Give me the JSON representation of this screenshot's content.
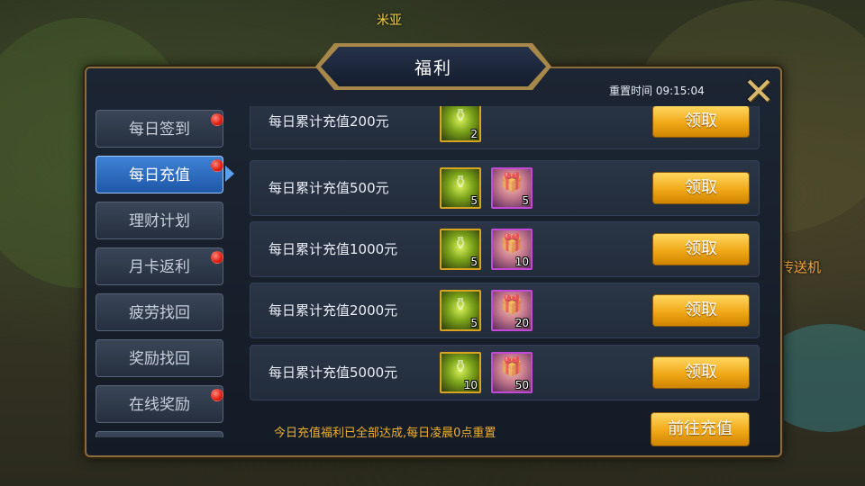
{
  "world": {
    "npc_name": "米亚",
    "portal_name": "传送机"
  },
  "panel": {
    "title": "福利",
    "reset_time": "重置时间 09:15:04",
    "close_icon": "close-x-icon"
  },
  "sidebar": {
    "items": [
      {
        "label": "每日签到",
        "badge": true,
        "active": false
      },
      {
        "label": "每日充值",
        "badge": true,
        "active": true
      },
      {
        "label": "理财计划",
        "badge": false,
        "active": false
      },
      {
        "label": "月卡返利",
        "badge": true,
        "active": false
      },
      {
        "label": "疲劳找回",
        "badge": false,
        "active": false
      },
      {
        "label": "奖励找回",
        "badge": false,
        "active": false
      },
      {
        "label": "在线奖励",
        "badge": true,
        "active": false
      }
    ]
  },
  "rewards": {
    "rows": [
      {
        "label": "每日累计充值200元",
        "items": [
          {
            "type": "gold",
            "icon": "potion-jar-icon",
            "count": "2"
          }
        ],
        "button": "领取"
      },
      {
        "label": "每日累计充值500元",
        "items": [
          {
            "type": "gold",
            "icon": "potion-jar-icon",
            "count": "5"
          },
          {
            "type": "purple",
            "icon": "gift-girl-icon",
            "count": "5"
          }
        ],
        "button": "领取"
      },
      {
        "label": "每日累计充值1000元",
        "items": [
          {
            "type": "gold",
            "icon": "potion-jar-icon",
            "count": "5"
          },
          {
            "type": "purple",
            "icon": "gift-girl-icon",
            "count": "10"
          }
        ],
        "button": "领取"
      },
      {
        "label": "每日累计充值2000元",
        "items": [
          {
            "type": "gold",
            "icon": "potion-jar-icon",
            "count": "5"
          },
          {
            "type": "purple",
            "icon": "gift-girl-icon",
            "count": "20"
          }
        ],
        "button": "领取"
      },
      {
        "label": "每日累计充值5000元",
        "items": [
          {
            "type": "gold",
            "icon": "potion-jar-icon",
            "count": "10"
          },
          {
            "type": "purple",
            "icon": "gift-girl-icon",
            "count": "50"
          }
        ],
        "button": "领取"
      }
    ]
  },
  "footer": {
    "note": "今日充值福利已全部达成,每日凌晨0点重置",
    "go_button": "前往充值"
  },
  "colors": {
    "accent_gold": "#f0a818",
    "active_tab": "#3f82d6",
    "badge_red": "#e01e12",
    "note_orange": "#f0b030"
  }
}
